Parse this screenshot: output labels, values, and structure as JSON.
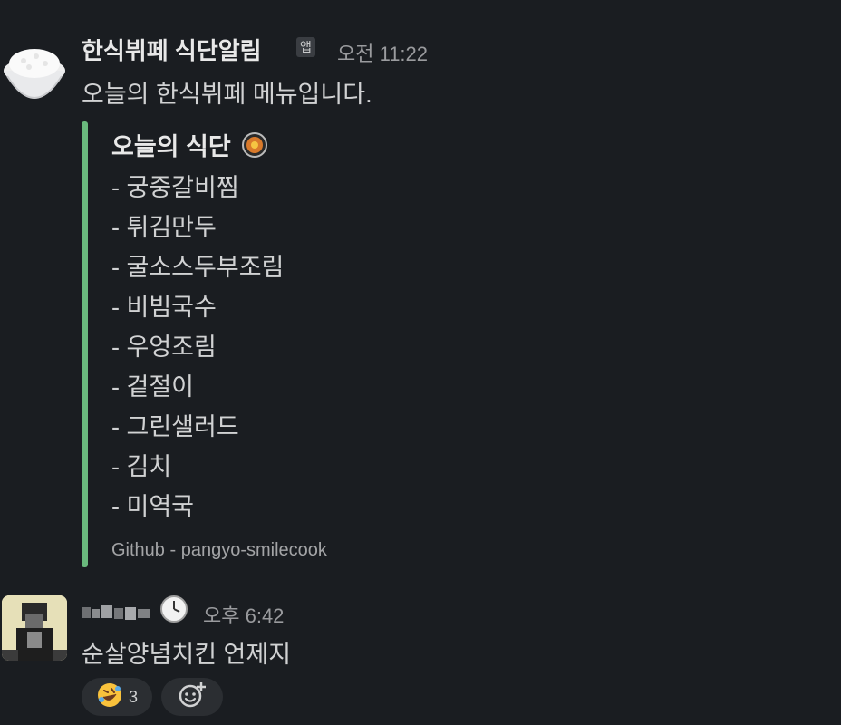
{
  "colors": {
    "background": "#1a1d21",
    "attachment_bar": "#6ab97d",
    "reaction_bg": "#2b2e32"
  },
  "message1": {
    "sender": "한식뷔페 식단알림",
    "badge": "앱",
    "time": "오전 11:22",
    "text": "오늘의 한식뷔페 메뉴입니다.",
    "avatar_icon": "rice-bowl-icon",
    "attachment": {
      "title": "오늘의 식단",
      "title_icon": "cooking-icon",
      "menu": [
        "- 궁중갈비찜",
        "- 튀김만두",
        "- 굴소스두부조림",
        "- 비빔국수",
        "- 우엉조림",
        "- 겉절이",
        "- 그린샐러드",
        "- 김치",
        "- 미역국"
      ],
      "footer": "Github - pangyo-smilecook"
    }
  },
  "message2": {
    "sender_icon": "blurred-name",
    "status_icon": "clock-icon",
    "time": "오후 6:42",
    "text": "순살양념치킨 언제지",
    "reactions": [
      {
        "icon": "rolling-on-floor-laughing-icon",
        "count": "3"
      }
    ],
    "add_reaction_icon": "add-reaction-icon"
  }
}
